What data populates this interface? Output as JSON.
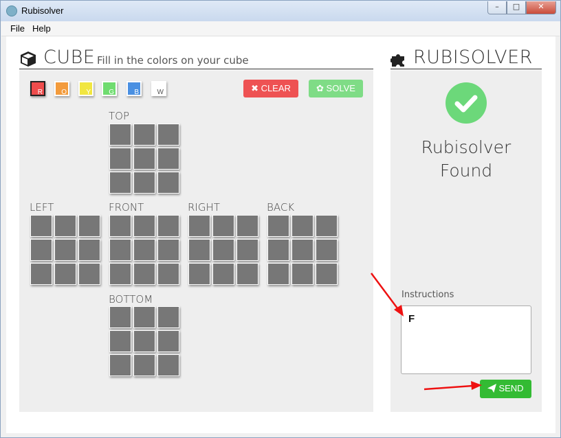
{
  "window": {
    "title": "Rubisolver",
    "controls": [
      "–",
      "□",
      "✕"
    ]
  },
  "menu": [
    "File",
    "Help"
  ],
  "cube_section": {
    "title": "CUBE",
    "subtitle": "Fill in the colors on your cube"
  },
  "swatches": [
    {
      "letter": "R",
      "color": "#ee4c4c",
      "selected": true
    },
    {
      "letter": "O",
      "color": "#f39b3c"
    },
    {
      "letter": "Y",
      "color": "#f1e640"
    },
    {
      "letter": "G",
      "color": "#6fdc6f"
    },
    {
      "letter": "B",
      "color": "#4a90e2"
    },
    {
      "letter": "W",
      "color": "#ffffff"
    }
  ],
  "buttons": {
    "clear": "✖ CLEAR",
    "solve": "✿ SOLVE",
    "send": "SEND"
  },
  "faces": {
    "top": "TOP",
    "left": "LEFT",
    "front": "FRONT",
    "right": "RIGHT",
    "back": "BACK",
    "bottom": "BOTTOM"
  },
  "sticker_color": "#777777",
  "solver_section": {
    "title": "RUBISOLVER",
    "status_line1": "Rubisolver",
    "status_line2": "Found"
  },
  "instructions": {
    "label": "Instructions",
    "value": "F"
  },
  "colors": {
    "accent_red": "#ee5253",
    "accent_green": "#7fdc86",
    "send_green": "#33bb33",
    "check_green": "#6cd87a",
    "arrow_red": "#ee1111"
  }
}
